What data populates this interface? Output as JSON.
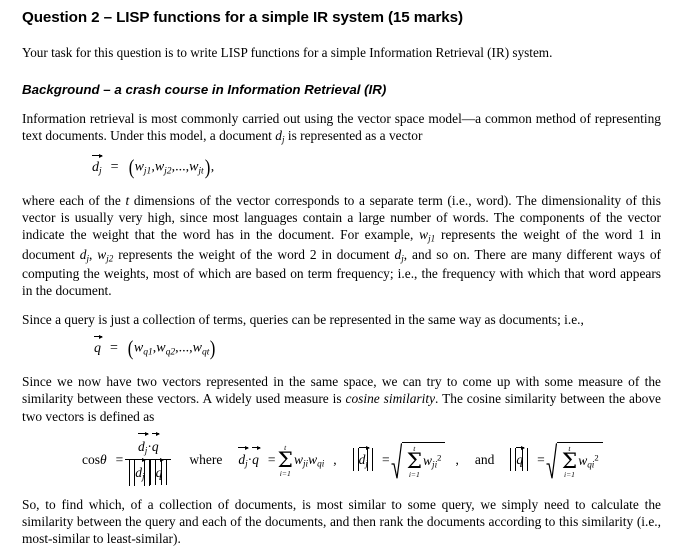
{
  "document": {
    "title": "Question 2 – LISP functions for a simple IR system (15 marks)",
    "intro": "Your task for this question is to write LISP functions for a simple Information Retrieval (IR) system.",
    "section_heading": "Background  – a crash course in Information Retrieval (IR)",
    "paragraphs": {
      "p1_a": "Information retrieval is most commonly carried out using the vector space model—a common method of representing text documents. Under this model, a document ",
      "p1_italic": "d",
      "p1_italic_sub": "j",
      "p1_b": " is represented as a vector",
      "p2_a": "where each of the ",
      "p2_t": "t",
      "p2_b": " dimensions of the vector corresponds to a separate term (i.e., word). The dimensionality of this vector is usually very high, since most languages contain a large number of words. The components of the vector indicate the weight that the word has in the document. For example, ",
      "p2_w1": "w",
      "p2_w1_sub": "j1",
      "p2_c": " represents the weight of the word 1 in document ",
      "p2_d1": "d",
      "p2_d1_sub": "j",
      "p2_d": ", ",
      "p2_w2": "w",
      "p2_w2_sub": "j2",
      "p2_e": " represents the weight of the word 2 in document ",
      "p2_d2": "d",
      "p2_d2_sub": "j",
      "p2_f": ", and so on. There are many different ways of computing the weights, most of which are based on term frequency; i.e., the frequency with which that word appears in the document.",
      "p3": "Since a query is just a collection of terms, queries can be represented in the same way as documents; i.e.,",
      "p4_a": "Since we now have two vectors represented in the same space, we can try to come up with some measure of the similarity between these vectors. A widely used measure is ",
      "p4_italic": "cosine similarity",
      "p4_b": ". The cosine similarity between the above two vectors is defined as",
      "p5": "So, to find which, of a collection of documents, is most similar to some query, we simply need to calculate the similarity between the query and each of the documents, and then rank the documents according to this similarity (i.e., most-similar to least-similar)."
    },
    "equations": {
      "eq1": {
        "lhs_symbol": "d",
        "lhs_sub": "j",
        "relation": "=",
        "open": "(",
        "terms": [
          "w",
          "w",
          "w"
        ],
        "term_subs": [
          "j1",
          "j2",
          "jt"
        ],
        "ellipsis": ",...,",
        "comma": ",",
        "close": ")",
        "trailing": ","
      },
      "eq2": {
        "lhs_symbol": "q",
        "relation": "=",
        "open": "(",
        "terms": [
          "w",
          "w",
          "w"
        ],
        "term_subs": [
          "q1",
          "q2",
          "qt"
        ],
        "ellipsis": ",...,",
        "comma": ",",
        "close": ")"
      },
      "eq3": {
        "cos": "cos",
        "theta": "θ",
        "relation": "=",
        "num_left": "d",
        "num_left_sub": "j",
        "dot": "·",
        "num_right": "q",
        "den_left": "d",
        "den_left_sub": "j",
        "den_right": "q",
        "where": "where",
        "dot_def_lhs_left": "d",
        "dot_def_lhs_left_sub": "j",
        "dot_def_lhs_right": "q",
        "sum_top": "t",
        "sum_bottom": "i=1",
        "sigma": "Σ",
        "sum_term_a": "w",
        "sum_term_a_sub": "ji",
        "sum_term_b": "w",
        "sum_term_b_sub": "qi",
        "comma": ",",
        "norm_d": "d",
        "norm_d_sub": "j",
        "norm_d_sum_term": "w",
        "norm_d_sum_sub": "ji",
        "norm_d_sum_sup": "2",
        "and": "and",
        "norm_q": "q",
        "norm_q_sum_term": "w",
        "norm_q_sum_sub": "qi",
        "norm_q_sum_sup": "2"
      }
    }
  },
  "colors": {
    "page_background": "#ffffff",
    "text": "#000000"
  }
}
